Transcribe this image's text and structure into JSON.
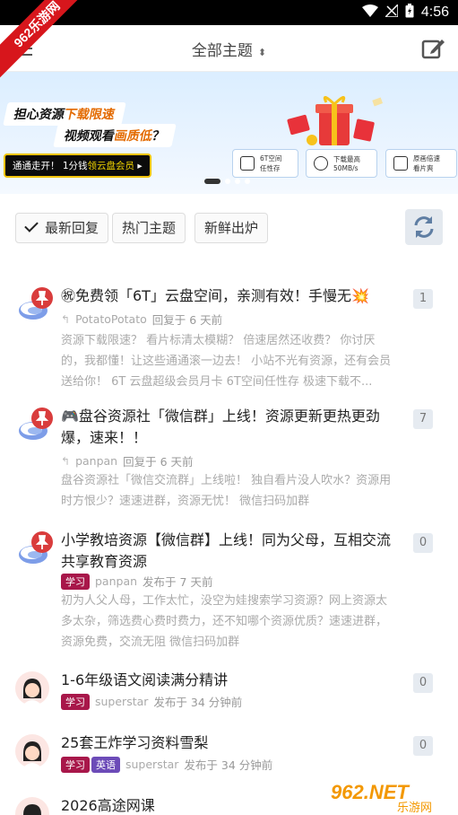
{
  "status_bar": {
    "time": "4:56"
  },
  "ribbon": {
    "label": "962乐游网"
  },
  "header": {
    "title": "全部主题"
  },
  "banner": {
    "line1": "担心资源",
    "line1_hl1": "下载限速",
    "line2": "视频观看",
    "line2_hl": "画质低",
    "line2_end": "？",
    "cta": "通通走开！ 1分钱",
    "cta_hl": "领云盘会员",
    "features": [
      {
        "line1": "6T空间",
        "line2": "任性存"
      },
      {
        "line1": "下载最高",
        "line2": "50MB/s"
      },
      {
        "line1": "原画倍速",
        "line2": "看片爽"
      }
    ]
  },
  "filters": {
    "latest": "最新回复",
    "hot": "热门主题",
    "fresh": "新鲜出炉"
  },
  "colors": {
    "tag_study": "#a8174a",
    "tag_english": "#6c4bb8",
    "pin": "#d93c3c"
  },
  "threads": [
    {
      "title": "㊗免费领「6T」云盘空间，亲测有效！手慢无💥",
      "user": "PotatoPotato",
      "action": "回复于 6 天前",
      "excerpt": "资源下载限速？ 看片标清太模糊？ 倍速居然还收费？ 你讨厌的，我都懂！让这些通通滚一边去！ 小站不光有资源，还有会员送给你！ 6T 云盘超级会员月卡 6T空间任性存 极速下载不...",
      "count": "1",
      "pinned": true,
      "tags": []
    },
    {
      "title": "🎮盘谷资源社「微信群」上线！资源更新更热更劲爆，速来！！",
      "user": "panpan",
      "action": "回复于 6 天前",
      "excerpt": "盘谷资源社「微信交流群」上线啦！ 独自看片没人吹水？资源用时方恨少？速速进群，资源无忧！ 微信扫码加群",
      "count": "7",
      "pinned": true,
      "tags": []
    },
    {
      "title": "小学教培资源【微信群】上线！同为父母，互相交流共享教育资源",
      "user": "panpan",
      "action": "发布于 7 天前",
      "excerpt": "初为人父人母，工作太忙，没空为娃搜索学习资源？网上资源太多太杂，筛选费心费时费力，还不知哪个资源优质？速速进群，资源免费，交流无阻 微信扫码加群",
      "count": "0",
      "pinned": true,
      "tags": [
        "学习"
      ]
    },
    {
      "title": "1-6年级语文阅读满分精讲",
      "user": "superstar",
      "action": "发布于 34 分钟前",
      "excerpt": "",
      "count": "0",
      "pinned": false,
      "tags": [
        "学习"
      ]
    },
    {
      "title": "25套王炸学习资料雪梨",
      "user": "superstar",
      "action": "发布于 34 分钟前",
      "excerpt": "",
      "count": "0",
      "pinned": false,
      "tags": [
        "学习",
        "英语"
      ]
    },
    {
      "title": "2026高途网课",
      "user": "",
      "action": "",
      "excerpt": "",
      "count": "",
      "pinned": false,
      "tags": []
    }
  ],
  "watermark": {
    "brand": "962.NET",
    "sub": "乐游网"
  }
}
